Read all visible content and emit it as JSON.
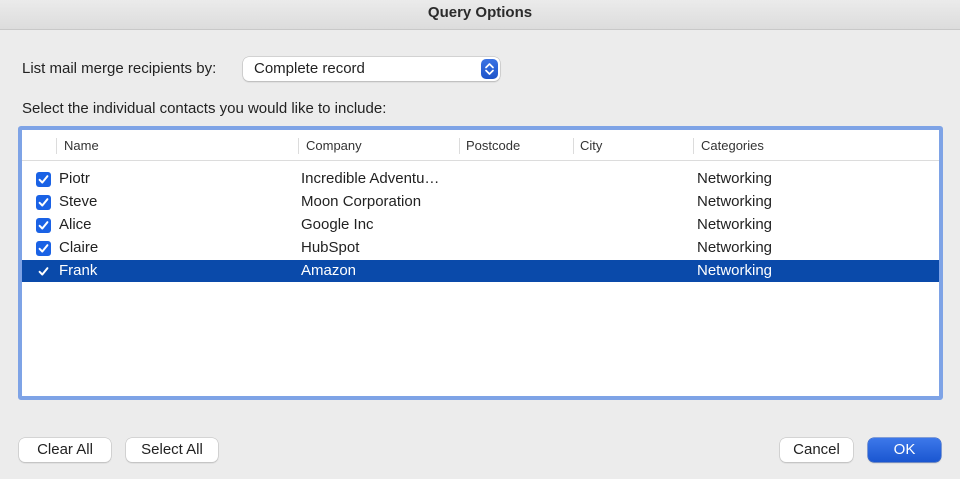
{
  "window": {
    "title": "Query Options"
  },
  "list_by": {
    "label": "List mail merge recipients by:",
    "selected_value": "Complete record"
  },
  "select_prompt": "Select the individual contacts you would like to include:",
  "table": {
    "columns": [
      "Name",
      "Company",
      "Postcode",
      "City",
      "Categories"
    ],
    "rows": [
      {
        "checked": true,
        "name": "Piotr",
        "company": "Incredible Adventu…",
        "postcode": "",
        "city": "",
        "categories": "Networking"
      },
      {
        "checked": true,
        "name": "Steve",
        "company": "Moon Corporation",
        "postcode": "",
        "city": "",
        "categories": "Networking"
      },
      {
        "checked": true,
        "name": "Alice",
        "company": "Google Inc",
        "postcode": "",
        "city": "",
        "categories": "Networking"
      },
      {
        "checked": true,
        "name": "Claire",
        "company": "HubSpot",
        "postcode": "",
        "city": "",
        "categories": "Networking"
      },
      {
        "checked": true,
        "name": "Frank",
        "company": "Amazon",
        "postcode": "",
        "city": "",
        "categories": "Networking",
        "selected": true
      }
    ]
  },
  "buttons": {
    "clear_all": "Clear All",
    "select_all": "Select All",
    "cancel": "Cancel",
    "ok": "OK"
  },
  "colors": {
    "accent": "#1a62e5",
    "selection": "#0a4aaa",
    "focus_ring": "#7ea3e6"
  },
  "icons": {
    "popup_stepper": "up-down-chevron-icon",
    "checkbox": "checkmark-icon"
  }
}
